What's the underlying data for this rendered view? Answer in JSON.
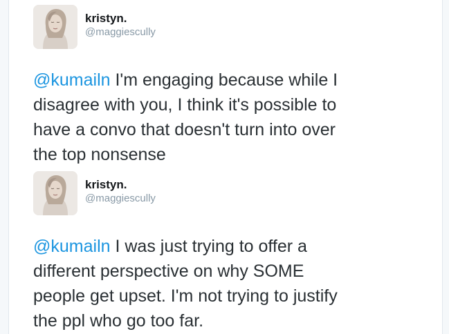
{
  "tweets": [
    {
      "display_name": "kristyn.",
      "handle": "@maggiescully",
      "mention": "@kumailn",
      "body": " I'm engaging because while I disagree with you, I think it's possible to have a convo that doesn't turn into over the top nonsense"
    },
    {
      "display_name": "kristyn.",
      "handle": "@maggiescully",
      "mention": "@kumailn",
      "body": " I was just trying to offer a different perspective on why SOME people get upset. I'm not trying to justify the ppl who go too far."
    }
  ],
  "colors": {
    "mention": "#1b95e0",
    "text": "#292f33",
    "handle": "#8899a6"
  }
}
